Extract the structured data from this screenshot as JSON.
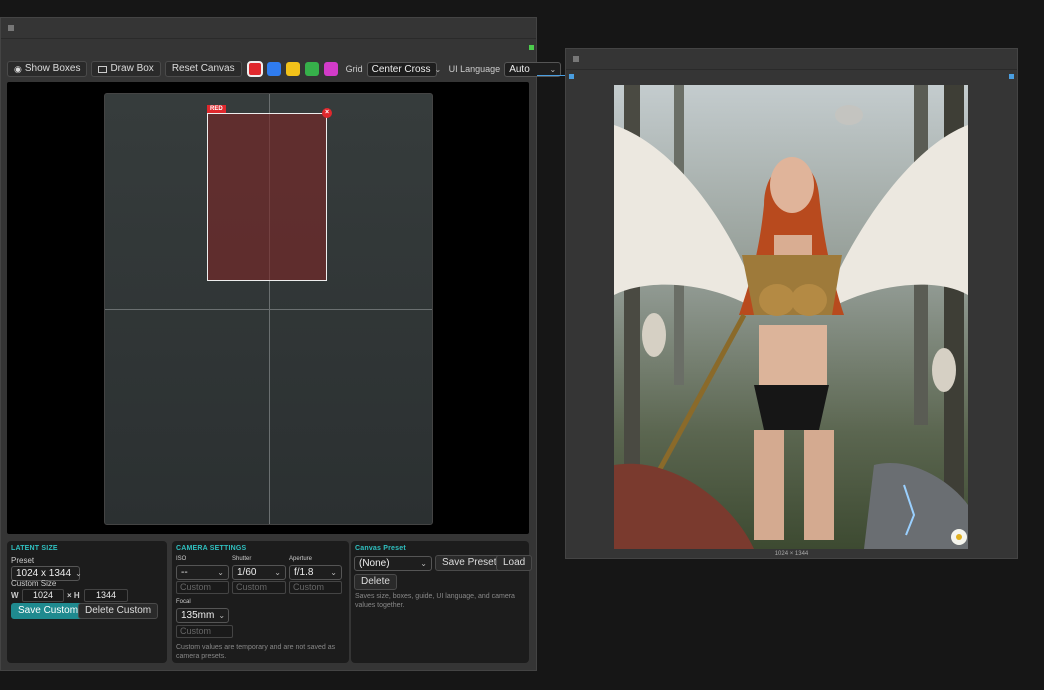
{
  "toolbar": {
    "show_boxes_label": "Show Boxes",
    "draw_box_label": "Draw Box",
    "reset_canvas_label": "Reset Canvas",
    "colors": [
      {
        "name": "red",
        "hex": "#e0282d",
        "selected": true
      },
      {
        "name": "blue",
        "hex": "#2f7cf0",
        "selected": false
      },
      {
        "name": "yellow",
        "hex": "#f2c21a",
        "selected": false
      },
      {
        "name": "green",
        "hex": "#36b04a",
        "selected": false
      },
      {
        "name": "magenta",
        "hex": "#d23bc8",
        "selected": false
      }
    ],
    "grid_label": "Grid",
    "grid_value": "Center Cross",
    "ui_language_label": "UI Language",
    "ui_language_value": "Auto"
  },
  "canvas": {
    "box_tag": "RED",
    "box_close": "×"
  },
  "latent_size": {
    "title": "LATENT SIZE",
    "preset_label": "Preset",
    "preset_value": "1024 x 1344",
    "custom_size_label": "Custom Size",
    "w_label": "W",
    "w_value": "1024",
    "x_label": "× H",
    "h_value": "1344",
    "save_custom_label": "Save Custom",
    "delete_custom_label": "Delete Custom"
  },
  "camera_settings": {
    "title": "CAMERA SETTINGS",
    "iso_label": "ISO",
    "iso_value": "--",
    "shutter_label": "Shutter",
    "shutter_value": "1/60",
    "aperture_label": "Aperture",
    "aperture_value": "f/1.8",
    "custom_placeholder": "Custom",
    "focal_label": "Focal",
    "focal_value": "135mm",
    "note": "Custom values are temporary and are not saved as camera presets."
  },
  "canvas_preset": {
    "title": "Canvas Preset",
    "value": "(None)",
    "save_preset_label": "Save Preset",
    "load_label": "Load",
    "delete_label": "Delete",
    "note": "Saves size, boxes, guide, UI language, and camera values together."
  },
  "preview": {
    "caption": "1024 × 1344"
  }
}
